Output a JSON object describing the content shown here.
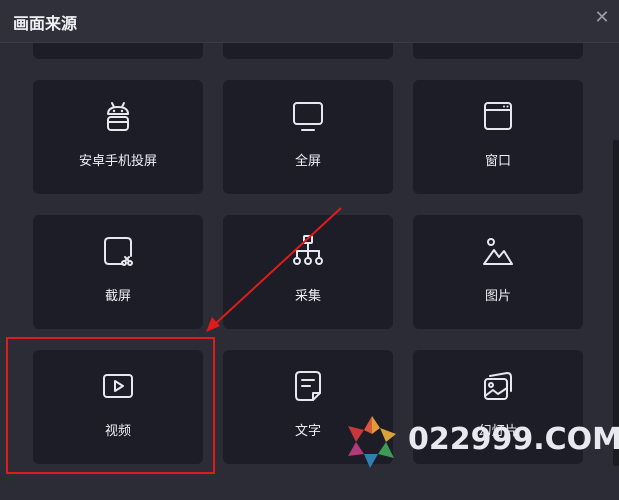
{
  "dialog": {
    "title": "画面来源",
    "close_icon": "close-icon"
  },
  "sources": [
    {
      "label": "安卓手机投屏",
      "icon": "android-icon"
    },
    {
      "label": "全屏",
      "icon": "monitor-icon"
    },
    {
      "label": "窗口",
      "icon": "window-icon"
    },
    {
      "label": "截屏",
      "icon": "screenshot-icon"
    },
    {
      "label": "采集",
      "icon": "capture-tree-icon"
    },
    {
      "label": "图片",
      "icon": "image-icon"
    },
    {
      "label": "视频",
      "icon": "video-icon"
    },
    {
      "label": "文字",
      "icon": "text-doc-icon"
    },
    {
      "label": "幻灯片",
      "icon": "slideshow-icon"
    }
  ],
  "watermark": {
    "text": "022999.COM"
  },
  "colors": {
    "highlight": "#e01b1b",
    "card": "#1c1d26",
    "background": "#2b2c35"
  }
}
